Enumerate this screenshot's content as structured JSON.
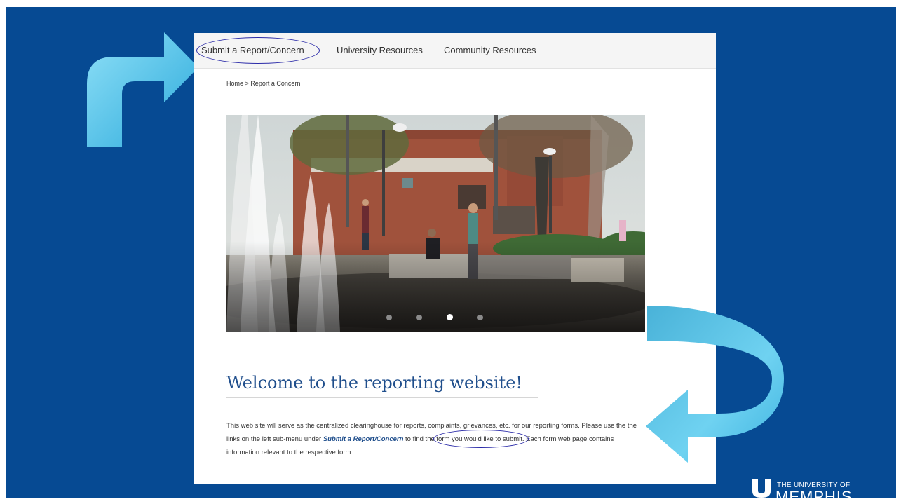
{
  "nav": {
    "items": [
      "Submit a Report/Concern",
      "University Resources",
      "Community Resources"
    ]
  },
  "breadcrumb": {
    "home": "Home",
    "separator": ">",
    "current": "Report a Concern"
  },
  "carousel": {
    "dot_count": 4,
    "active_index": 2
  },
  "main": {
    "heading": "Welcome to the reporting website!",
    "paragraph_before": "This web site will serve as the centralized clearinghouse for reports, complaints, grievances, etc. for our reporting forms. Please use the the links on the left sub-menu under ",
    "paragraph_link": "Submit a Report/Concern",
    "paragraph_after": " to find the form you would like to submit. Each form web page contains information relevant to the respective form."
  },
  "logo": {
    "line1": "THE UNIVERSITY OF",
    "line2": "MEMPHIS."
  },
  "colors": {
    "slide_bg": "#064a93",
    "arrow": "#5ec8ea",
    "heading": "#1f4e8c",
    "annotation": "#2a2aa8"
  }
}
